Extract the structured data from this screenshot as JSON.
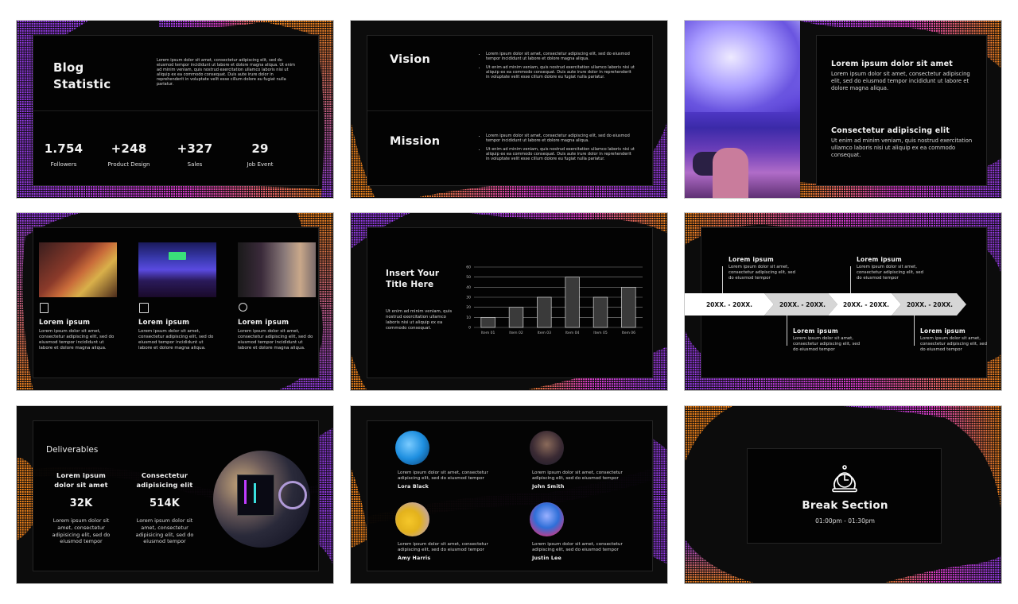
{
  "colors": {
    "page_bg": "#ffffff",
    "slide_bg": "#0c0c0c",
    "panel_bg": "#030303",
    "wave_purple": "#9b3cf0",
    "wave_magenta": "#e03ccf",
    "wave_orange": "#ff8a1c",
    "text_white": "#f2f2f2"
  },
  "slides": [
    {
      "id": "blog-statistic",
      "title_line1": "Blog",
      "title_line2": "Statistic",
      "paragraph": "Lorem ipsum dolor sit amet, consectetur adipiscing elit, sed do eiusmod tempor incididunt ut labore et dolore magna aliqua. Ut enim ad minim veniam, quis nostrud exercitation ullamco laboris nisi ut aliquip ex ea commodo consequat. Duis aute irure dolor in reprehenderit in voluptate velit esse cillum dolore eu fugiat nulla pariatur.",
      "stats": [
        {
          "value": "1.754",
          "label": "Followers"
        },
        {
          "value": "+248",
          "label": "Product Design"
        },
        {
          "value": "+327",
          "label": "Sales"
        },
        {
          "value": "29",
          "label": "Job Event"
        }
      ]
    },
    {
      "id": "vision-mission",
      "sections": [
        {
          "title": "Vision",
          "bullets": [
            "Lorem ipsum dolor sit amet, consectetur adipiscing elit, sed do eiusmod tempor incididunt ut labore et dolore magna aliqua.",
            "Ut enim ad minim veniam, quis nostrud exercitation ullamco laboris nisi ut aliquip ex ea commodo consequat. Duis aute irure dolor in reprehenderit in voluptate velit esse cillum dolore eu fugiat nulla pariatur."
          ]
        },
        {
          "title": "Mission",
          "bullets": [
            "Lorem ipsum dolor sit amet, consectetur adipiscing elit, sed do eiusmod tempor incididunt ut labore et dolore magna aliqua.",
            "Ut enim ad minim veniam, quis nostrud exercitation ullamco laboris nisi ut aliquip ex ea commodo consequat. Duis aute irure dolor in reprehenderit in voluptate velit esse cillum dolore eu fugiat nulla pariatur."
          ]
        }
      ]
    },
    {
      "id": "photo-text",
      "photo_desc": "Gamer holding controller in front of purple-lit monitor",
      "blocks": [
        {
          "heading": "Lorem ipsum dolor sit amet",
          "text": "Lorem ipsum dolor sit amet, consectetur adipiscing elit, sed do eiusmod tempor incididunt ut labore et dolore magna aliqua."
        },
        {
          "heading": "Consectetur adipiscing elit",
          "text": "Ut enim ad minim veniam, quis nostrud exercitation ullamco laboris nisi ut aliquip ex ea commodo consequat."
        }
      ]
    },
    {
      "id": "three-columns",
      "columns": [
        {
          "icon": "document-edit-icon",
          "photo_desc": "Gamer with headset at screens",
          "heading": "Lorem ipsum",
          "text": "Lorem ipsum dolor sit amet, consectetur adipiscing elit, sed do eiusmod tempor incididunt ut labore et dolore magna aliqua."
        },
        {
          "icon": "newspaper-icon",
          "photo_desc": "Esports battle arena",
          "heading": "Lorem ipsum",
          "text": "Lorem ipsum dolor sit amet, consectetur adipiscing elit, sed do eiusmod tempor incididunt ut labore et dolore magna aliqua."
        },
        {
          "icon": "target-icon",
          "photo_desc": "Streamer at microphone",
          "heading": "Lorem ipsum",
          "text": "Lorem ipsum dolor sit amet, consectetur adipiscing elit, sed do eiusmod tempor incididunt ut labore et dolore magna aliqua."
        }
      ]
    },
    {
      "id": "chart-slide",
      "title_line1": "Insert Your",
      "title_line2": "Title Here",
      "text": "Ut enim ad minim veniam, quis nostrud exercitation ullamco laboris nisi ut aliquip ex ea commodo consequat."
    },
    {
      "id": "timeline",
      "periods": [
        "20XX. - 20XX.",
        "20XX. - 20XX.",
        "20XX. - 20XX.",
        "20XX. - 20XX."
      ],
      "events": [
        {
          "heading": "Lorem ipsum",
          "text": "Lorem ipsum dolor sit amet, consectetur adipiscing elit, sed do eiusmod tempor"
        },
        {
          "heading": "Lorem ipsum",
          "text": "Lorem ipsum dolor sit amet, consectetur adipiscing elit, sed do eiusmod tempor"
        },
        {
          "heading": "Lorem ipsum",
          "text": "Lorem ipsum dolor sit amet, consectetur adipiscing elit, sed do eiusmod tempor"
        },
        {
          "heading": "Lorem ipsum",
          "text": "Lorem ipsum dolor sit amet, consectetur adipiscing elit, sed do eiusmod tempor"
        }
      ]
    },
    {
      "id": "deliverables",
      "title": "Deliverables",
      "photo_desc": "Gaming PC setup with RGB lights",
      "items": [
        {
          "heading_line1": "Lorem ipsum",
          "heading_line2": "dolor sit amet",
          "value": "32K",
          "text": "Lorem ipsum dolor sit amet, consectetur adipisicing elit, sed do eiusmod tempor"
        },
        {
          "heading_line1": "Consectetur",
          "heading_line2": "adipisicing elit",
          "value": "514K",
          "text": "Lorem ipsum dolor sit amet, consectetur adipisicing elit, sed do eiusmod tempor"
        }
      ]
    },
    {
      "id": "team",
      "members": [
        {
          "name": "Lora Black",
          "text": "Lorem ipsum dolor sit amet, consectetur adipiscing elit, sed do eiusmod tempor",
          "photo_color": "#1e8fe0"
        },
        {
          "name": "John Smith",
          "text": "Lorem ipsum dolor sit amet, consectetur adipiscing elit, sed do eiusmod tempor",
          "photo_color": "#3a2a33"
        },
        {
          "name": "Amy Harris",
          "text": "Lorem ipsum dolor sit amet, consectetur adipiscing elit, sed do eiusmod tempor",
          "photo_color": "#e3b21c"
        },
        {
          "name": "Justin Lee",
          "text": "Lorem ipsum dolor sit amet, consectetur adipiscing elit, sed do eiusmod tempor",
          "photo_color": "#2f6fd8"
        }
      ]
    },
    {
      "id": "break-section",
      "icon": "stopwatch-icon",
      "title": "Break Section",
      "time": "01:00pm - 01:30pm"
    }
  ],
  "chart_data": {
    "type": "bar",
    "title": "",
    "xlabel": "",
    "ylabel": "",
    "categories": [
      "Item 01",
      "Item 02",
      "Item 03",
      "Item 04",
      "Item 05",
      "Item 06"
    ],
    "values": [
      10,
      20,
      30,
      50,
      30,
      40
    ],
    "ylim": [
      0,
      60
    ],
    "yticks": [
      0,
      10,
      20,
      30,
      40,
      50,
      60
    ],
    "grid": true,
    "legend": "none"
  }
}
